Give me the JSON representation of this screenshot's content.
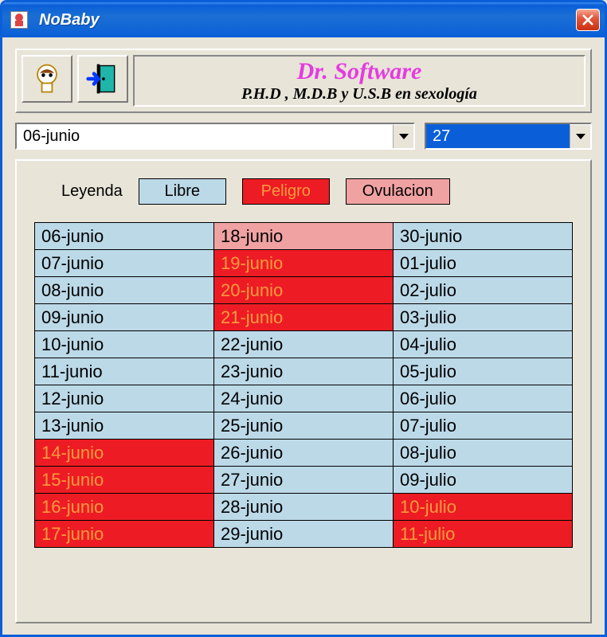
{
  "window": {
    "title": "NoBaby"
  },
  "header": {
    "brand": "Dr. Software",
    "subtitle": "P.H.D , M.D.B y  U.S.B en sexología"
  },
  "selectors": {
    "month": "06-junio",
    "day": "27"
  },
  "legend": {
    "label": "Leyenda",
    "libre": "Libre",
    "peligro": "Peligro",
    "ovulacion": "Ovulacion"
  },
  "calendar": {
    "rows": [
      [
        {
          "text": "06-junio",
          "state": "libre"
        },
        {
          "text": "18-junio",
          "state": "ovul"
        },
        {
          "text": "30-junio",
          "state": "libre"
        }
      ],
      [
        {
          "text": "07-junio",
          "state": "libre"
        },
        {
          "text": "19-junio",
          "state": "peligro"
        },
        {
          "text": "01-julio",
          "state": "libre"
        }
      ],
      [
        {
          "text": "08-junio",
          "state": "libre"
        },
        {
          "text": "20-junio",
          "state": "peligro"
        },
        {
          "text": "02-julio",
          "state": "libre"
        }
      ],
      [
        {
          "text": "09-junio",
          "state": "libre"
        },
        {
          "text": "21-junio",
          "state": "peligro"
        },
        {
          "text": "03-julio",
          "state": "libre"
        }
      ],
      [
        {
          "text": "10-junio",
          "state": "libre"
        },
        {
          "text": "22-junio",
          "state": "libre"
        },
        {
          "text": "04-julio",
          "state": "libre"
        }
      ],
      [
        {
          "text": "11-junio",
          "state": "libre"
        },
        {
          "text": "23-junio",
          "state": "libre"
        },
        {
          "text": "05-julio",
          "state": "libre"
        }
      ],
      [
        {
          "text": "12-junio",
          "state": "libre"
        },
        {
          "text": "24-junio",
          "state": "libre"
        },
        {
          "text": "06-julio",
          "state": "libre"
        }
      ],
      [
        {
          "text": "13-junio",
          "state": "libre"
        },
        {
          "text": "25-junio",
          "state": "libre"
        },
        {
          "text": "07-julio",
          "state": "libre"
        }
      ],
      [
        {
          "text": "14-junio",
          "state": "peligro"
        },
        {
          "text": "26-junio",
          "state": "libre"
        },
        {
          "text": "08-julio",
          "state": "libre"
        }
      ],
      [
        {
          "text": "15-junio",
          "state": "peligro"
        },
        {
          "text": "27-junio",
          "state": "libre"
        },
        {
          "text": "09-julio",
          "state": "libre"
        }
      ],
      [
        {
          "text": "16-junio",
          "state": "peligro"
        },
        {
          "text": "28-junio",
          "state": "libre"
        },
        {
          "text": "10-julio",
          "state": "peligro"
        }
      ],
      [
        {
          "text": "17-junio",
          "state": "peligro"
        },
        {
          "text": "29-junio",
          "state": "libre"
        },
        {
          "text": "11-julio",
          "state": "peligro"
        }
      ]
    ]
  }
}
